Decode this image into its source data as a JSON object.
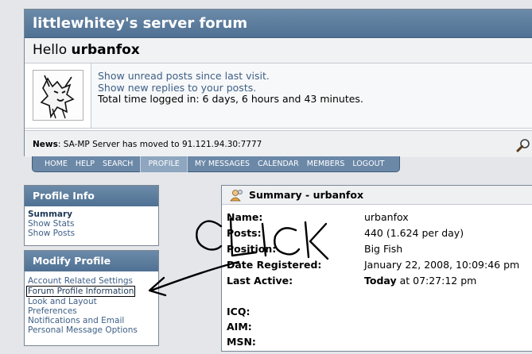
{
  "forum": {
    "title": "littlewhitey's server forum",
    "hello_prefix": "Hello ",
    "username": "urbanfox",
    "links": {
      "unread": "Show unread posts since last visit.",
      "replies": "Show new replies to your posts.",
      "time_logged": "Total time logged in: 6 days, 6 hours and 43 minutes."
    },
    "news_label": "News",
    "news_text": ": SA-MP Server has moved to 91.121.94.30:7777"
  },
  "menu": [
    "HOME",
    "HELP",
    "SEARCH",
    "PROFILE",
    "MY MESSAGES",
    "CALENDAR",
    "MEMBERS",
    "LOGOUT"
  ],
  "profile_info": {
    "header": "Profile Info",
    "items": [
      "Summary",
      "Show Stats",
      "Show Posts"
    ]
  },
  "modify_profile": {
    "header": "Modify Profile",
    "items": [
      "Account Related Settings",
      "Forum Profile Information",
      "Look and Layout",
      "Preferences",
      "Notifications and Email",
      "Personal Message Options"
    ]
  },
  "summary": {
    "header": "Summary - urbanfox",
    "rows": [
      {
        "label": "Name:",
        "value": "urbanfox"
      },
      {
        "label": "Posts:",
        "value": "440 (1.624 per day)"
      },
      {
        "label": "Position:",
        "value": "Big Fish"
      },
      {
        "label": "Date Registered:",
        "value": "January 22, 2008, 10:09:46 pm"
      },
      {
        "label": "Last Active:",
        "value_bold": "Today",
        "value": " at 07:27:12 pm"
      },
      {
        "label": "",
        "value": ""
      },
      {
        "label": "ICQ:",
        "value": ""
      },
      {
        "label": "AIM:",
        "value": ""
      },
      {
        "label": "MSN:",
        "value": ""
      }
    ]
  },
  "annotation": {
    "scribble_text": "CLICK"
  },
  "colors": {
    "header_blue": "#5e7d9e",
    "link_blue": "#3d5f86",
    "background": "#e4e6ea"
  }
}
